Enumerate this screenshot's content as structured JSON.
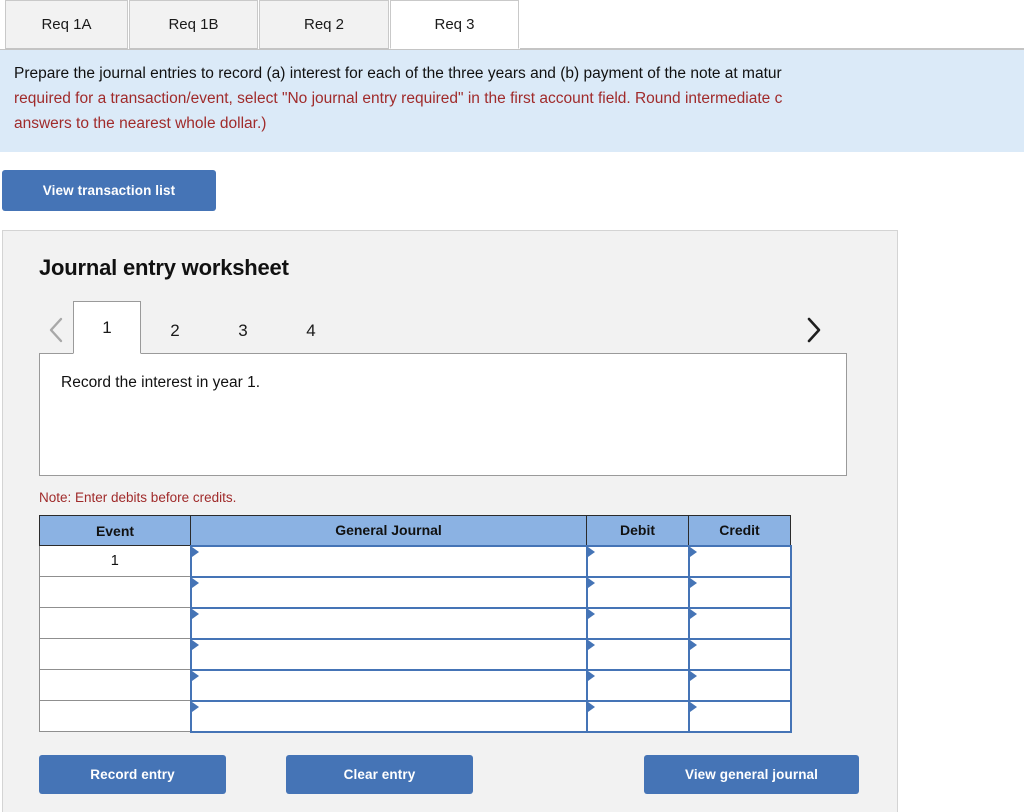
{
  "req_tabs": [
    {
      "label": "Req 1A",
      "active": false,
      "width": 123
    },
    {
      "label": "Req 1B",
      "active": false,
      "width": 129
    },
    {
      "label": "Req 2",
      "active": false,
      "width": 130
    },
    {
      "label": "Req 3",
      "active": true,
      "width": 129
    }
  ],
  "instructions": {
    "line1": "Prepare the journal entries to record (a) interest for each of the three years and (b) payment of the note at matur",
    "line2": "required for a transaction/event, select \"No journal entry required\" in the first account field. Round intermediate c",
    "line3": "answers to the nearest whole dollar.)"
  },
  "toolbar": {
    "view_transaction_list": "View transaction list"
  },
  "worksheet": {
    "title": "Journal entry worksheet",
    "prev_icon": "chevron-left-icon",
    "next_icon": "chevron-right-icon",
    "pages": [
      {
        "label": "1",
        "active": true
      },
      {
        "label": "2",
        "active": false
      },
      {
        "label": "3",
        "active": false
      },
      {
        "label": "4",
        "active": false
      }
    ],
    "description": "Record the interest in year 1.",
    "note": "Note: Enter debits before credits."
  },
  "table": {
    "headers": [
      "Event",
      "General Journal",
      "Debit",
      "Credit"
    ],
    "rows": [
      {
        "event": "1",
        "general_journal": "",
        "debit": "",
        "credit": ""
      },
      {
        "event": "",
        "general_journal": "",
        "debit": "",
        "credit": ""
      },
      {
        "event": "",
        "general_journal": "",
        "debit": "",
        "credit": ""
      },
      {
        "event": "",
        "general_journal": "",
        "debit": "",
        "credit": ""
      },
      {
        "event": "",
        "general_journal": "",
        "debit": "",
        "credit": ""
      },
      {
        "event": "",
        "general_journal": "",
        "debit": "",
        "credit": ""
      }
    ]
  },
  "footer": {
    "record_entry": "Record entry",
    "clear_entry": "Clear entry",
    "view_general_journal": "View general journal"
  },
  "colors": {
    "button_blue": "#4574b6",
    "table_header_blue": "#8bb2e3",
    "instruction_bg": "#dbeaf8",
    "panel_bg": "#f2f2f2",
    "note_red": "#a02b2b"
  }
}
